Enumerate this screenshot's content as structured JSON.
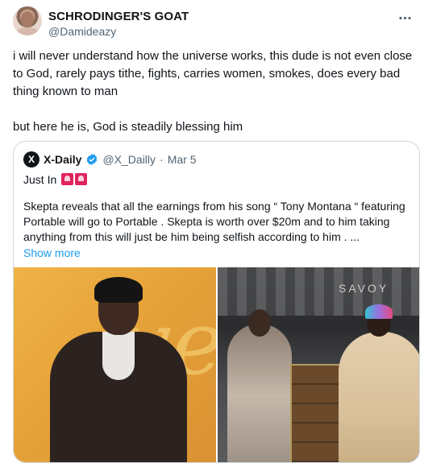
{
  "tweet": {
    "author": {
      "name": "SCHRODINGER'S GOAT",
      "handle": "@Damideazy"
    },
    "text": [
      "i will never understand how the universe works, this dude is not even close to God, rarely pays tithe, fights, carries women, smokes, does every bad thing known to man",
      "but here he is, God is steadily blessing him"
    ],
    "more_icon": "more-horizontal-icon"
  },
  "quoted": {
    "avatar_letter": "X",
    "name": "X-Daily",
    "verified_icon": "verified-badge-icon",
    "handle": "@X_Dailly",
    "dot": "·",
    "date": "Mar 5",
    "just_in": "Just In",
    "just_in_emojis": [
      "police-light-emoji",
      "police-light-emoji"
    ],
    "body": "Skepta reveals that all the earnings from his song “ Tony Montana “ featuring Portable will go to Portable .  Skepta is worth over $20m  and to him taking anything from this will just be him being selfish according to him .  ...",
    "show_more": "Show more",
    "media_labels": {
      "right_sign": "SAVOY"
    }
  },
  "colors": {
    "accent": "#1d9bf0",
    "text": "#0f1419",
    "muted": "#536471",
    "border": "#cfd9de"
  }
}
